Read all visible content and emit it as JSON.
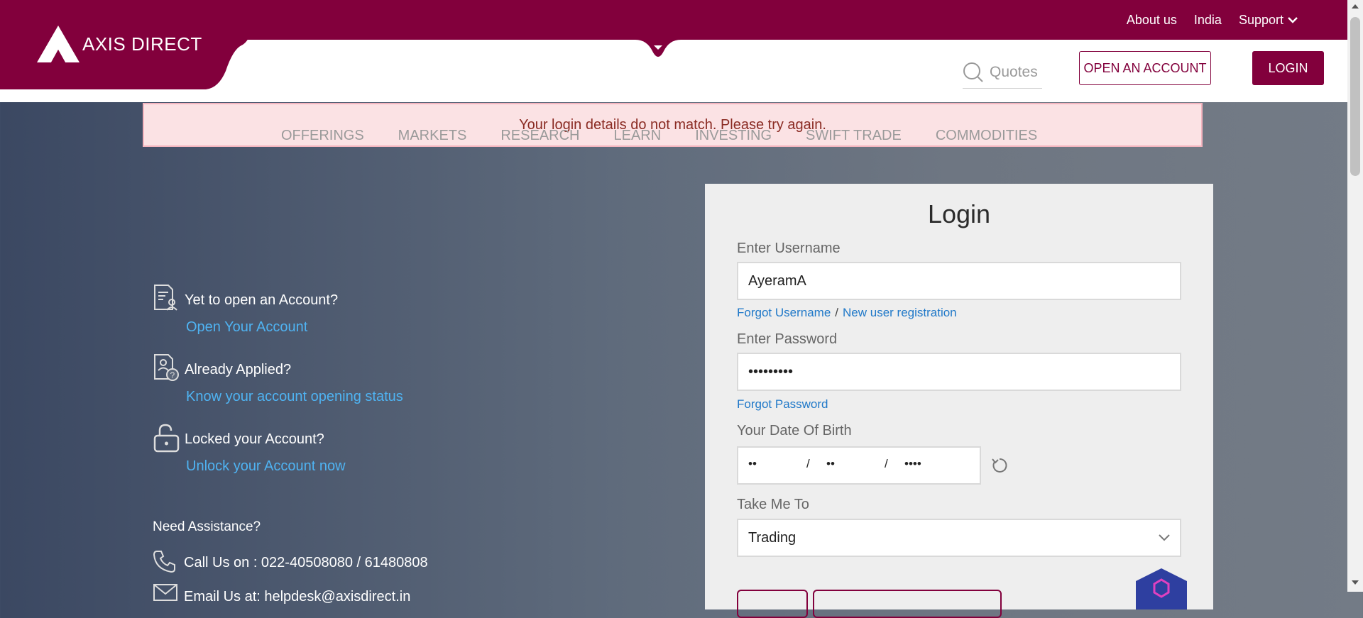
{
  "header": {
    "brand": "AXIS DIRECT",
    "top_links": [
      "About us",
      "India",
      "Support"
    ],
    "quotes_placeholder": "Quotes",
    "open_account": "OPEN AN ACCOUNT",
    "login": "LOGIN",
    "accent_color": "#82003c"
  },
  "alert": {
    "message": "Your login details do not match. Please try again."
  },
  "nav": {
    "items": [
      "OFFERINGS",
      "MARKETS",
      "RESEARCH",
      "LEARN",
      "INVESTING",
      "SWIFT TRADE",
      "COMMODITIES"
    ]
  },
  "login_form": {
    "title": "Login",
    "username_label": "Enter Username",
    "username_value": "AyeramA",
    "forgot_username": "Forgot Username",
    "separator": "/",
    "new_user": "New user registration",
    "password_label": "Enter Password",
    "password_value": "•••••••••",
    "forgot_password": "Forgot Password",
    "dob_label": "Your Date Of Birth",
    "dob_day": "••",
    "dob_month": "••",
    "dob_year": "••••",
    "dob_sep": "/",
    "take_me_to_label": "Take Me To",
    "take_me_to_value": "Trading"
  },
  "left_panel": {
    "q1": "Yet to open an Account?",
    "a1": "Open Your Account",
    "q2": "Already Applied?",
    "a2": "Know your account opening status",
    "q3": "Locked your Account?",
    "a3": "Unlock your Account now",
    "assist": "Need Assistance?",
    "call": "Call Us on : 022-40508080 / 61480808",
    "email": "Email Us at: helpdesk@axisdirect.in"
  }
}
